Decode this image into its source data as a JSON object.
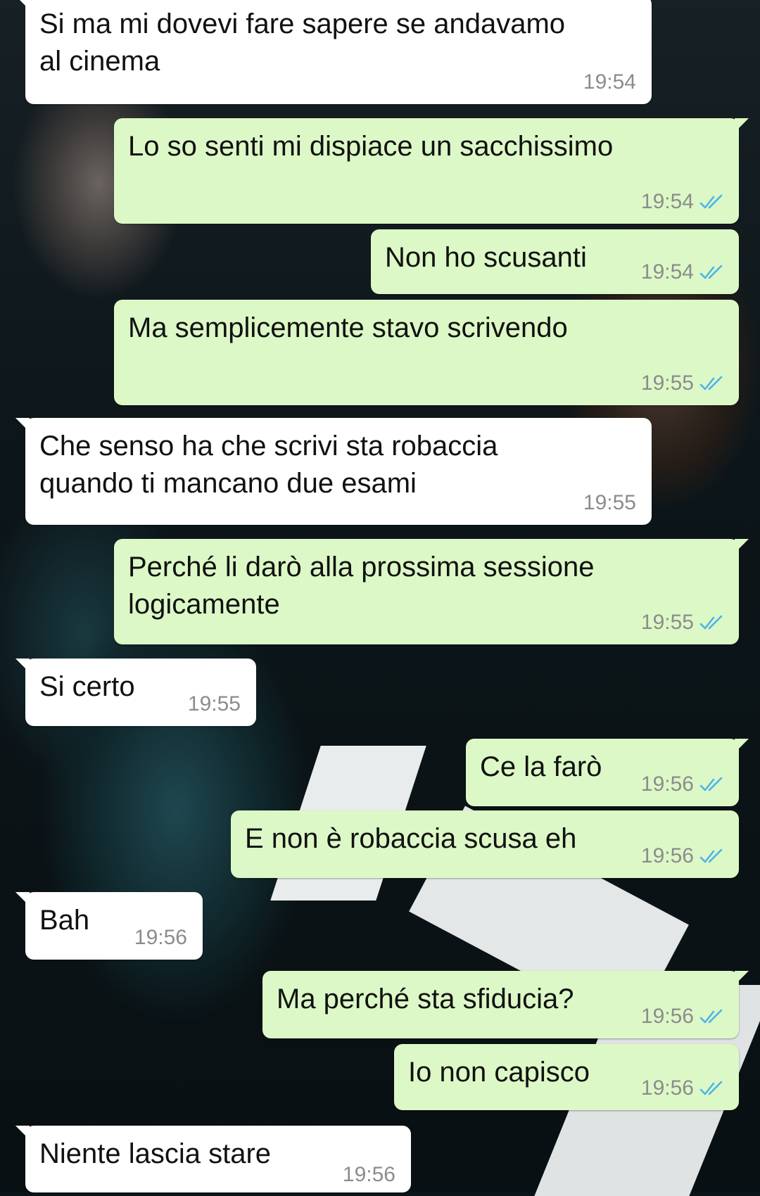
{
  "theme": {
    "incoming_bubble": "#ffffff",
    "outgoing_bubble": "#dcf8c6",
    "read_ticks_color": "#4fb3e8",
    "timestamp_color": "#8c8c8c"
  },
  "messages": [
    {
      "direction": "incoming",
      "text": "Si ma mi dovevi fare sapere se andavamo\nal cinema",
      "time": "19:54"
    },
    {
      "direction": "outgoing",
      "text": "Lo so senti mi dispiace un sacchissimo",
      "time": "19:54",
      "status": "read",
      "status_icon": "double-check-icon"
    },
    {
      "direction": "outgoing",
      "text": "Non ho scusanti",
      "time": "19:54",
      "status": "read",
      "status_icon": "double-check-icon"
    },
    {
      "direction": "outgoing",
      "text": "Ma semplicemente stavo scrivendo",
      "time": "19:55",
      "status": "read",
      "status_icon": "double-check-icon"
    },
    {
      "direction": "incoming",
      "text": "Che senso ha che scrivi sta robaccia\nquando ti mancano due esami",
      "time": "19:55"
    },
    {
      "direction": "outgoing",
      "text": "Perché li darò alla prossima sessione\nlogicamente",
      "time": "19:55",
      "status": "read",
      "status_icon": "double-check-icon"
    },
    {
      "direction": "incoming",
      "text": "Si certo",
      "time": "19:55"
    },
    {
      "direction": "outgoing",
      "text": "Ce la farò",
      "time": "19:56",
      "status": "read",
      "status_icon": "double-check-icon"
    },
    {
      "direction": "outgoing",
      "text": "E non è robaccia scusa eh",
      "time": "19:56",
      "status": "read",
      "status_icon": "double-check-icon"
    },
    {
      "direction": "incoming",
      "text": "Bah",
      "time": "19:56"
    },
    {
      "direction": "outgoing",
      "text": "Ma perché sta sfiducia?",
      "time": "19:56",
      "status": "read",
      "status_icon": "double-check-icon"
    },
    {
      "direction": "outgoing",
      "text": "Io non capisco",
      "time": "19:56",
      "status": "read",
      "status_icon": "double-check-icon"
    },
    {
      "direction": "incoming",
      "text": "Niente lascia stare",
      "time": "19:56"
    }
  ]
}
